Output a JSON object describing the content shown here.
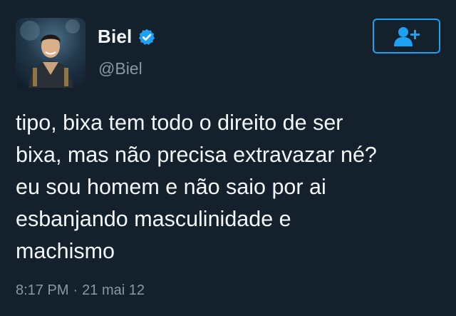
{
  "author": {
    "display_name": "Biel",
    "handle": "@Biel",
    "verified_icon": "verified-badge-icon",
    "avatar_icon": "profile-photo"
  },
  "follow_button": {
    "icon": "add-user-icon",
    "accent": "#1da1f2"
  },
  "tweet": {
    "lines": [
      "tipo, bixa tem todo o direito de ser",
      "bixa, mas não precisa extravazar né?",
      "eu sou homem e não saio por ai",
      "esbanjando masculinidade e",
      "machismo"
    ],
    "time": "8:17 PM",
    "separator": "·",
    "date": "21 mai 12"
  },
  "colors": {
    "background": "#14202c",
    "text": "#f5f8fa",
    "muted": "#8899a6",
    "accent": "#1da1f2"
  }
}
